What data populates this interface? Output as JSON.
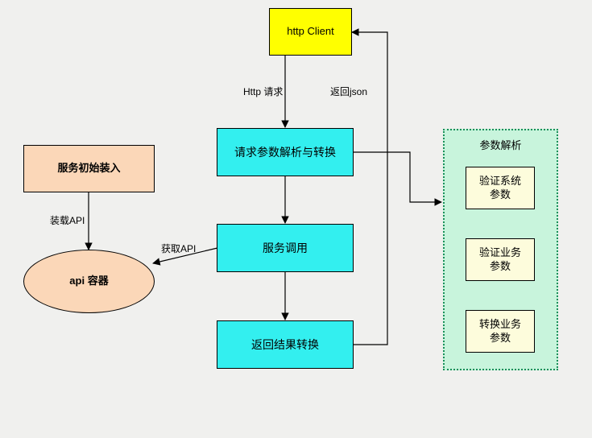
{
  "nodes": {
    "http_client": "http Client",
    "init_load": "服务初始装入",
    "api_container": "api 容器",
    "req_parse": "请求参数解析与转换",
    "service_call": "服务调用",
    "result_conv": "返回结果转换",
    "param_group_title": "参数解析",
    "validate_sys": "验证系统\n参数",
    "validate_biz": "验证业务\n参数",
    "convert_biz": "转换业务\n参数"
  },
  "edges": {
    "http_req": "Http 请求",
    "return_json": "返回json",
    "load_api": "装载API",
    "get_api": "获取API"
  }
}
